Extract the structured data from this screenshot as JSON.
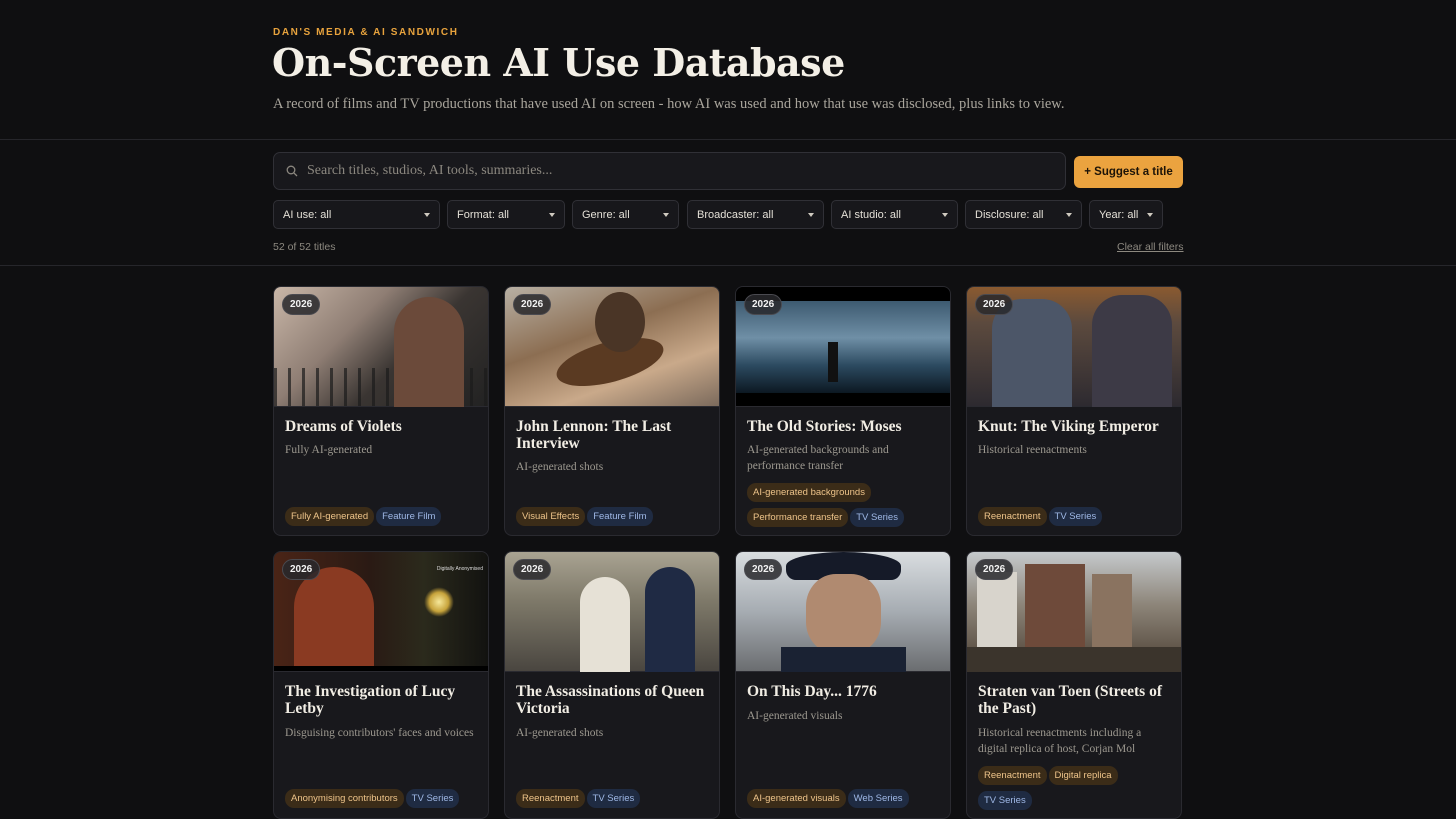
{
  "header": {
    "brand": "DAN'S MEDIA & AI SANDWICH",
    "title": "On-Screen AI Use Database",
    "subtitle": "A record of films and TV productions that have used AI on screen - how AI was used and how that use was disclosed, plus links to view."
  },
  "search": {
    "placeholder": "Search titles, studios, AI tools, summaries..."
  },
  "suggest_label": "+ Suggest a title",
  "filters": [
    "AI use: all",
    "Format: all",
    "Genre: all",
    "Broadcaster: all",
    "AI studio: all",
    "Disclosure: all",
    "Year: all"
  ],
  "count_text": "52 of 52 titles",
  "clear_label": "Clear all filters",
  "cards": [
    {
      "year": "2026",
      "title": "Dreams of Violets",
      "summary": "Fully AI-generated",
      "ai_tags": [
        "Fully AI-generated"
      ],
      "format_tags": [
        "Feature Film"
      ]
    },
    {
      "year": "2026",
      "title": "John Lennon: The Last Interview",
      "summary": "AI-generated shots",
      "ai_tags": [
        "Visual Effects"
      ],
      "format_tags": [
        "Feature Film"
      ]
    },
    {
      "year": "2026",
      "title": "The Old Stories: Moses",
      "summary": "AI-generated backgrounds and performance transfer",
      "ai_tags": [
        "AI-generated backgrounds",
        "Performance transfer"
      ],
      "format_tags": [
        "TV Series"
      ]
    },
    {
      "year": "2026",
      "title": "Knut: The Viking Emperor",
      "summary": "Historical reenactments",
      "ai_tags": [
        "Reenactment"
      ],
      "format_tags": [
        "TV Series"
      ]
    },
    {
      "year": "2026",
      "title": "The Investigation of Lucy Letby",
      "summary": "Disguising contributors' faces and voices",
      "ai_tags": [
        "Anonymising contributors"
      ],
      "format_tags": [
        "TV Series"
      ],
      "thumb_caption": "Digitally Anonymised"
    },
    {
      "year": "2026",
      "title": "The Assassinations of Queen Victoria",
      "summary": "AI-generated shots",
      "ai_tags": [
        "Reenactment"
      ],
      "format_tags": [
        "TV Series"
      ]
    },
    {
      "year": "2026",
      "title": "On This Day... 1776",
      "summary": "AI-generated visuals",
      "ai_tags": [
        "AI-generated visuals"
      ],
      "format_tags": [
        "Web Series"
      ]
    },
    {
      "year": "2026",
      "title": "Straten van Toen (Streets of the Past)",
      "summary": "Historical reenactments including a digital replica of host, Corjan Mol",
      "ai_tags": [
        "Reenactment",
        "Digital replica"
      ],
      "format_tags": [
        "TV Series"
      ]
    }
  ]
}
